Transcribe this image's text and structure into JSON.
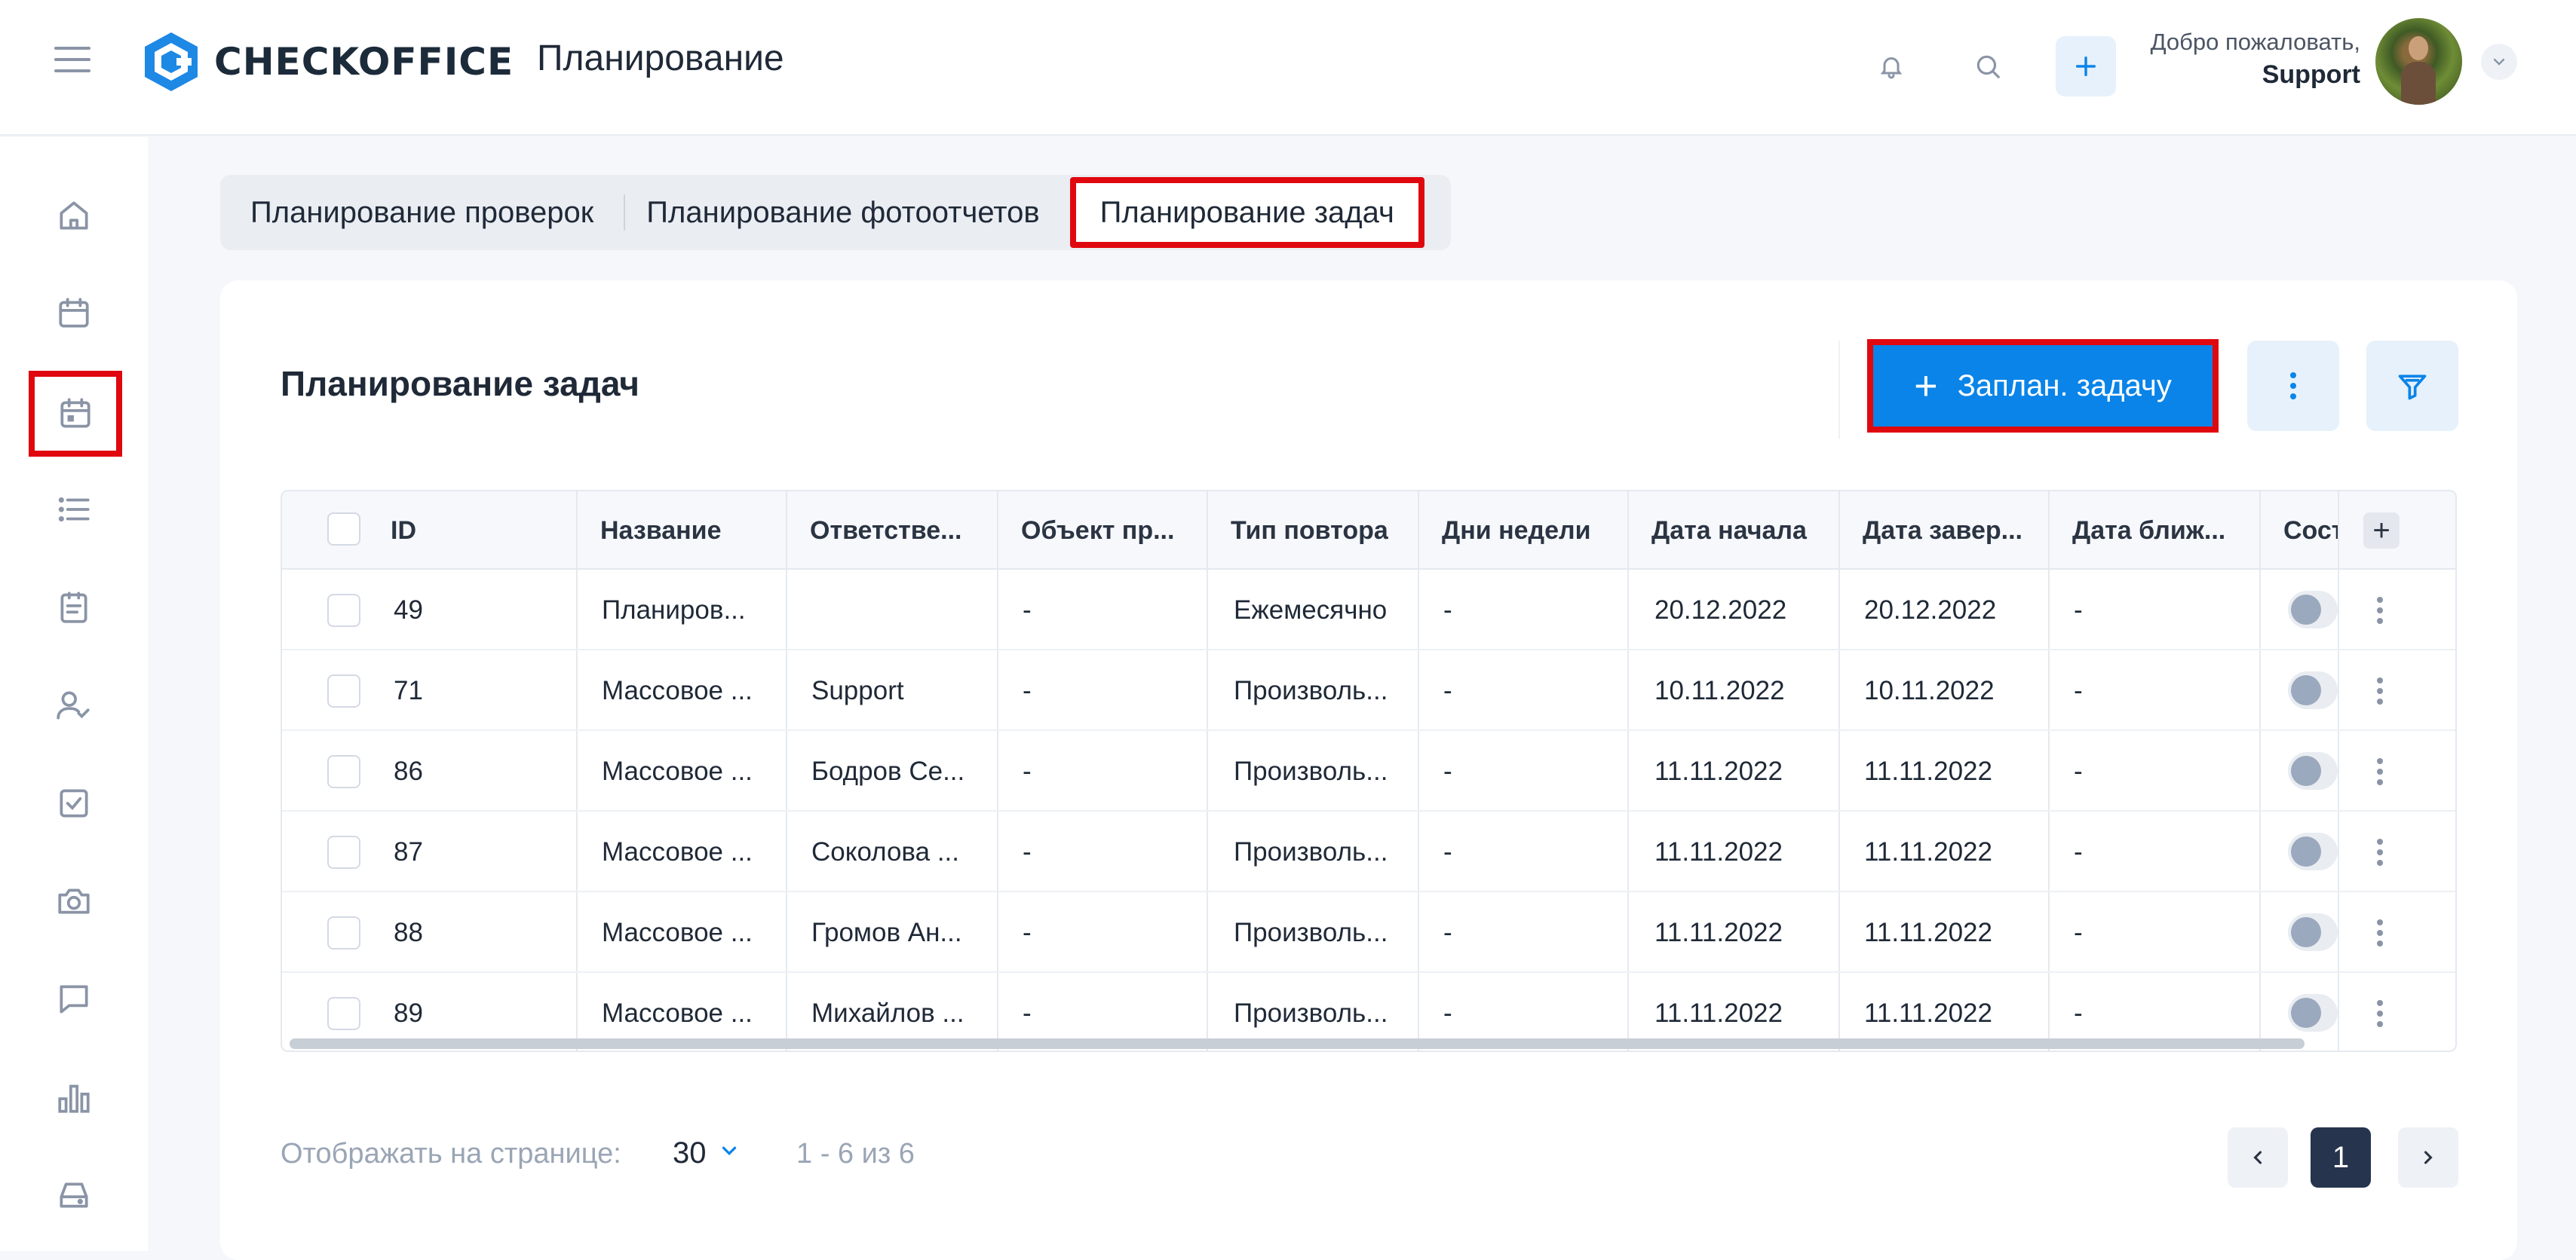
{
  "header": {
    "logo_text": "CHECKOFFICE",
    "page_title": "Планирование",
    "welcome_text": "Добро пожаловать,",
    "user_name": "Support"
  },
  "tabs": [
    {
      "label": "Планирование проверок"
    },
    {
      "label": "Планирование фотоотчетов"
    },
    {
      "label": "Планирование задач",
      "active": true
    }
  ],
  "card": {
    "title": "Планирование задач",
    "primary_button": "Заплан. задачу"
  },
  "table": {
    "columns": [
      "ID",
      "Название",
      "Ответстве...",
      "Объект пр...",
      "Тип повтора",
      "Дни недели",
      "Дата начала",
      "Дата завер...",
      "Дата ближ...",
      "Сост"
    ],
    "rows": [
      {
        "id": "49",
        "name": "Планиров...",
        "resp": "",
        "obj": "-",
        "repeat": "Ежемесячно",
        "days": "-",
        "start": "20.12.2022",
        "end": "20.12.2022",
        "near": "-"
      },
      {
        "id": "71",
        "name": "Массовое ...",
        "resp": "Support",
        "obj": "-",
        "repeat": "Произволь...",
        "days": "-",
        "start": "10.11.2022",
        "end": "10.11.2022",
        "near": "-"
      },
      {
        "id": "86",
        "name": "Массовое ...",
        "resp": "Бодров Се...",
        "obj": "-",
        "repeat": "Произволь...",
        "days": "-",
        "start": "11.11.2022",
        "end": "11.11.2022",
        "near": "-"
      },
      {
        "id": "87",
        "name": "Массовое ...",
        "resp": "Соколова ...",
        "obj": "-",
        "repeat": "Произволь...",
        "days": "-",
        "start": "11.11.2022",
        "end": "11.11.2022",
        "near": "-"
      },
      {
        "id": "88",
        "name": "Массовое ...",
        "resp": "Громов Ан...",
        "obj": "-",
        "repeat": "Произволь...",
        "days": "-",
        "start": "11.11.2022",
        "end": "11.11.2022",
        "near": "-"
      },
      {
        "id": "89",
        "name": "Массовое ...",
        "resp": "Михайлов ...",
        "obj": "-",
        "repeat": "Произволь...",
        "days": "-",
        "start": "11.11.2022",
        "end": "11.11.2022",
        "near": "-"
      }
    ]
  },
  "pagination": {
    "per_page_label": "Отображать на странице:",
    "per_page_value": "30",
    "range_text": "1 - 6 из 6",
    "current_page": "1"
  },
  "sidebar_icons": [
    "home-icon",
    "calendar-icon",
    "calendar-planning-icon",
    "list-icon",
    "clipboard-icon",
    "user-check-icon",
    "checkbox-icon",
    "camera-icon",
    "chat-icon",
    "bar-chart-icon",
    "storage-icon"
  ],
  "colors": {
    "accent": "#0a84e8",
    "highlight": "#e0080f",
    "pagination_active": "#26344d"
  }
}
